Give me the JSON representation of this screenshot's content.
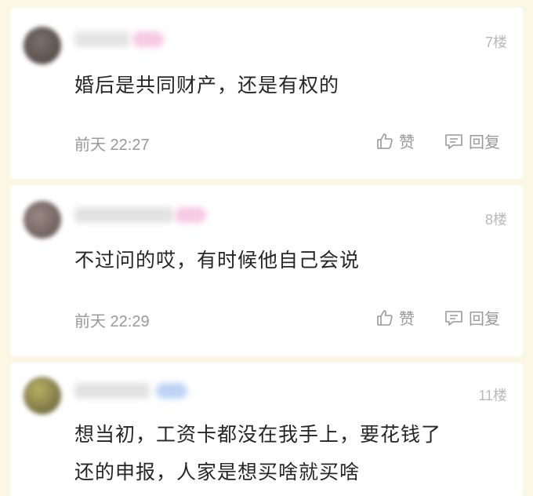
{
  "comments": [
    {
      "floor": "7楼",
      "content": "婚后是共同财产，还是有权的",
      "time": "前天 22:27",
      "like_label": "赞",
      "reply_label": "回复"
    },
    {
      "floor": "8楼",
      "content": "不过问的哎，有时候他自己会说",
      "time": "前天 22:29",
      "like_label": "赞",
      "reply_label": "回复"
    },
    {
      "floor": "11楼",
      "content_line1": "想当初，工资卡都没在我手上，要花钱了",
      "content_line2": "还的申报，人家是想买啥就买啥"
    }
  ],
  "colors": {
    "page_background": "#faf8e4",
    "card_background": "#ffffff",
    "text": "#262626",
    "meta_text": "#999999",
    "floor_text": "#b9b9b9",
    "badge_pink": "#f6c9e4",
    "badge_blue": "#bcd3f6"
  },
  "icons": {
    "like": "thumbs-up-icon",
    "reply": "comment-bubble-icon"
  }
}
